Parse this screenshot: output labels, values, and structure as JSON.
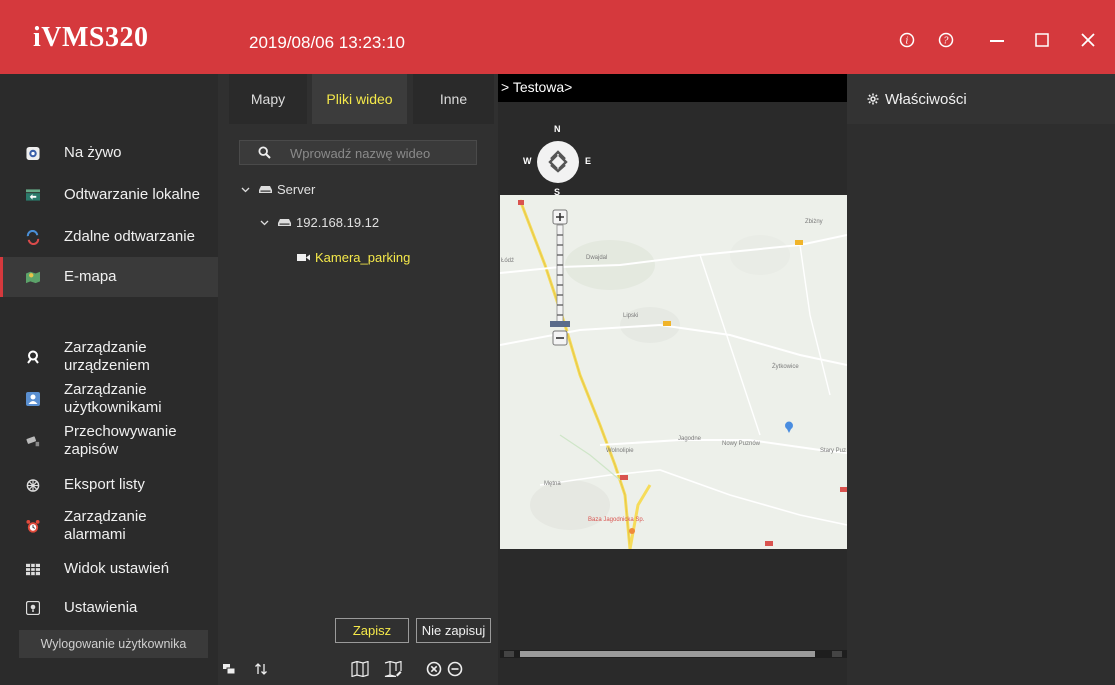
{
  "titlebar": {
    "app_title": "iVMS320",
    "datetime": "2019/08/06 13:23:10",
    "controls": [
      "info-icon",
      "help-icon",
      "minimize-icon",
      "maximize-icon",
      "close-icon"
    ]
  },
  "sidebar": {
    "items": [
      {
        "label": "Na żywo",
        "icon": "live-view-icon"
      },
      {
        "label": "Odtwarzanie lokalne",
        "icon": "local-playback-icon"
      },
      {
        "label": "Zdalne odtwarzanie",
        "icon": "remote-playback-icon"
      },
      {
        "label": "E-mapa",
        "icon": "emap-icon",
        "active": true
      },
      {
        "label": "Zarządzanie urządzeniem",
        "icon": "device-management-icon"
      },
      {
        "label": "Zarządzanie użytkownikami",
        "icon": "user-management-icon"
      },
      {
        "label": "Przechowywanie zapisów",
        "icon": "storage-icon"
      },
      {
        "label": "Eksport listy",
        "icon": "export-icon"
      },
      {
        "label": "Zarządzanie alarmami",
        "icon": "alarm-icon"
      },
      {
        "label": "Widok ustawień",
        "icon": "view-settings-icon"
      },
      {
        "label": "Ustawienia",
        "icon": "settings-icon"
      }
    ],
    "logout_label": "Wylogowanie użytkownika"
  },
  "midpanel": {
    "tabs": [
      {
        "label": "Mapy"
      },
      {
        "label": "Pliki wideo",
        "active": true
      },
      {
        "label": "Inne"
      }
    ],
    "search": {
      "placeholder": "Wprowadź nazwę wideo",
      "value": ""
    },
    "tree": {
      "root": "Server",
      "device": "192.168.19.12",
      "camera": "Kamera_parking"
    },
    "save_label": "Zapisz",
    "nosave_label": "Nie zapisuj",
    "bottom_tools": [
      "layers-icon",
      "sort-icon",
      "map-add-icon",
      "map-edit-icon",
      "delete-icon",
      "remove-icon"
    ]
  },
  "map": {
    "path": "> Testowa>",
    "compass": {
      "n": "N",
      "s": "S",
      "e": "E",
      "w": "W"
    },
    "place_labels": [
      "Zbiżny",
      "Łódź",
      "Dwajdal",
      "Lipski",
      "Żytkowice",
      "Jagodne",
      "Nowy Puznów",
      "Stary Puz",
      "Wolnolipie",
      "Mętna",
      "Baza Jagodnicka Sp."
    ]
  },
  "proppanel": {
    "title": "Właściwości"
  },
  "colors": {
    "accent_red": "#d5393d",
    "highlight_yellow": "#f5e94a"
  }
}
